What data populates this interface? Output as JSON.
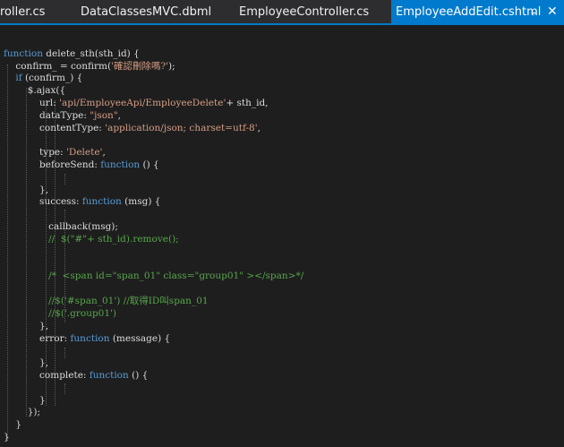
{
  "tabs": [
    {
      "label": "roller.cs",
      "active": false
    },
    {
      "label": "DataClassesMVC.dbml",
      "active": false
    },
    {
      "label": "EmployeeController.cs",
      "active": false
    },
    {
      "label": "EmployeeAddEdit.cshtml",
      "active": true
    }
  ],
  "icons": {
    "pin": "pin-icon",
    "close": "close-icon"
  },
  "colors": {
    "background": "#1e1e1e",
    "tab_active": "#007acc",
    "keyword": "#569cd6",
    "string": "#d69d85",
    "comment": "#57a64a",
    "text": "#dcdcdc"
  },
  "code": {
    "l1": [
      {
        "t": "function",
        "c": "kw"
      },
      {
        "t": " delete_sth(sth_id) {",
        "c": ""
      }
    ],
    "l2": [
      {
        "t": "    confirm_ = confirm(",
        "c": ""
      },
      {
        "t": "'確認刪除嗎?'",
        "c": "str"
      },
      {
        "t": ");",
        "c": ""
      }
    ],
    "l3": [
      {
        "t": "    ",
        "c": ""
      },
      {
        "t": "if",
        "c": "kw"
      },
      {
        "t": " (confirm_) {",
        "c": ""
      }
    ],
    "l4": [
      {
        "t": "        $.ajax({",
        "c": ""
      }
    ],
    "l5": [
      {
        "t": "            url: ",
        "c": ""
      },
      {
        "t": "'api/EmployeeApi/EmployeeDelete'",
        "c": "str"
      },
      {
        "t": "+ sth_id,",
        "c": ""
      }
    ],
    "l6": [
      {
        "t": "            dataType: ",
        "c": ""
      },
      {
        "t": "\"json\"",
        "c": "str"
      },
      {
        "t": ",",
        "c": ""
      }
    ],
    "l7": [
      {
        "t": "            contentType: ",
        "c": ""
      },
      {
        "t": "'application/json; charset=utf-8'",
        "c": "str"
      },
      {
        "t": ",",
        "c": ""
      }
    ],
    "l8": [],
    "l9": [
      {
        "t": "            type: ",
        "c": ""
      },
      {
        "t": "'Delete'",
        "c": "str"
      },
      {
        "t": ",",
        "c": ""
      }
    ],
    "l10": [
      {
        "t": "            beforeSend: ",
        "c": ""
      },
      {
        "t": "function",
        "c": "kw"
      },
      {
        "t": " () {",
        "c": ""
      }
    ],
    "l11": [],
    "l12": [
      {
        "t": "            },",
        "c": ""
      }
    ],
    "l13": [
      {
        "t": "            success: ",
        "c": ""
      },
      {
        "t": "function",
        "c": "kw"
      },
      {
        "t": " (msg) {",
        "c": ""
      }
    ],
    "l14": [],
    "l15": [
      {
        "t": "               callback(msg);",
        "c": ""
      }
    ],
    "l16": [
      {
        "t": "               //  $(\"#\"+ sth_id).remove();",
        "c": "cm"
      }
    ],
    "l17": [],
    "l18": [],
    "l19": [],
    "l20": [
      {
        "t": "               /*  <span id=\"span_01\" class=\"group01\" ></span>*/",
        "c": "cm"
      }
    ],
    "l21": [],
    "l22": [
      {
        "t": "               //$('#span_01') //取得ID叫span_01",
        "c": "cm"
      }
    ],
    "l23": [
      {
        "t": "               //$('.group01')",
        "c": "cm"
      }
    ],
    "l24": [
      {
        "t": "            },",
        "c": ""
      }
    ],
    "l25": [
      {
        "t": "            error: ",
        "c": ""
      },
      {
        "t": "function",
        "c": "kw"
      },
      {
        "t": " (message) {",
        "c": ""
      }
    ],
    "l26": [],
    "l27": [
      {
        "t": "            },",
        "c": ""
      }
    ],
    "l28": [
      {
        "t": "            complete: ",
        "c": ""
      },
      {
        "t": "function",
        "c": "kw"
      },
      {
        "t": " () {",
        "c": ""
      }
    ],
    "l29": [],
    "l30": [
      {
        "t": "            }",
        "c": ""
      }
    ],
    "l31": [
      {
        "t": "        });",
        "c": ""
      }
    ],
    "l32": [
      {
        "t": "    }",
        "c": ""
      }
    ],
    "l33": [
      {
        "t": "}",
        "c": ""
      }
    ]
  }
}
